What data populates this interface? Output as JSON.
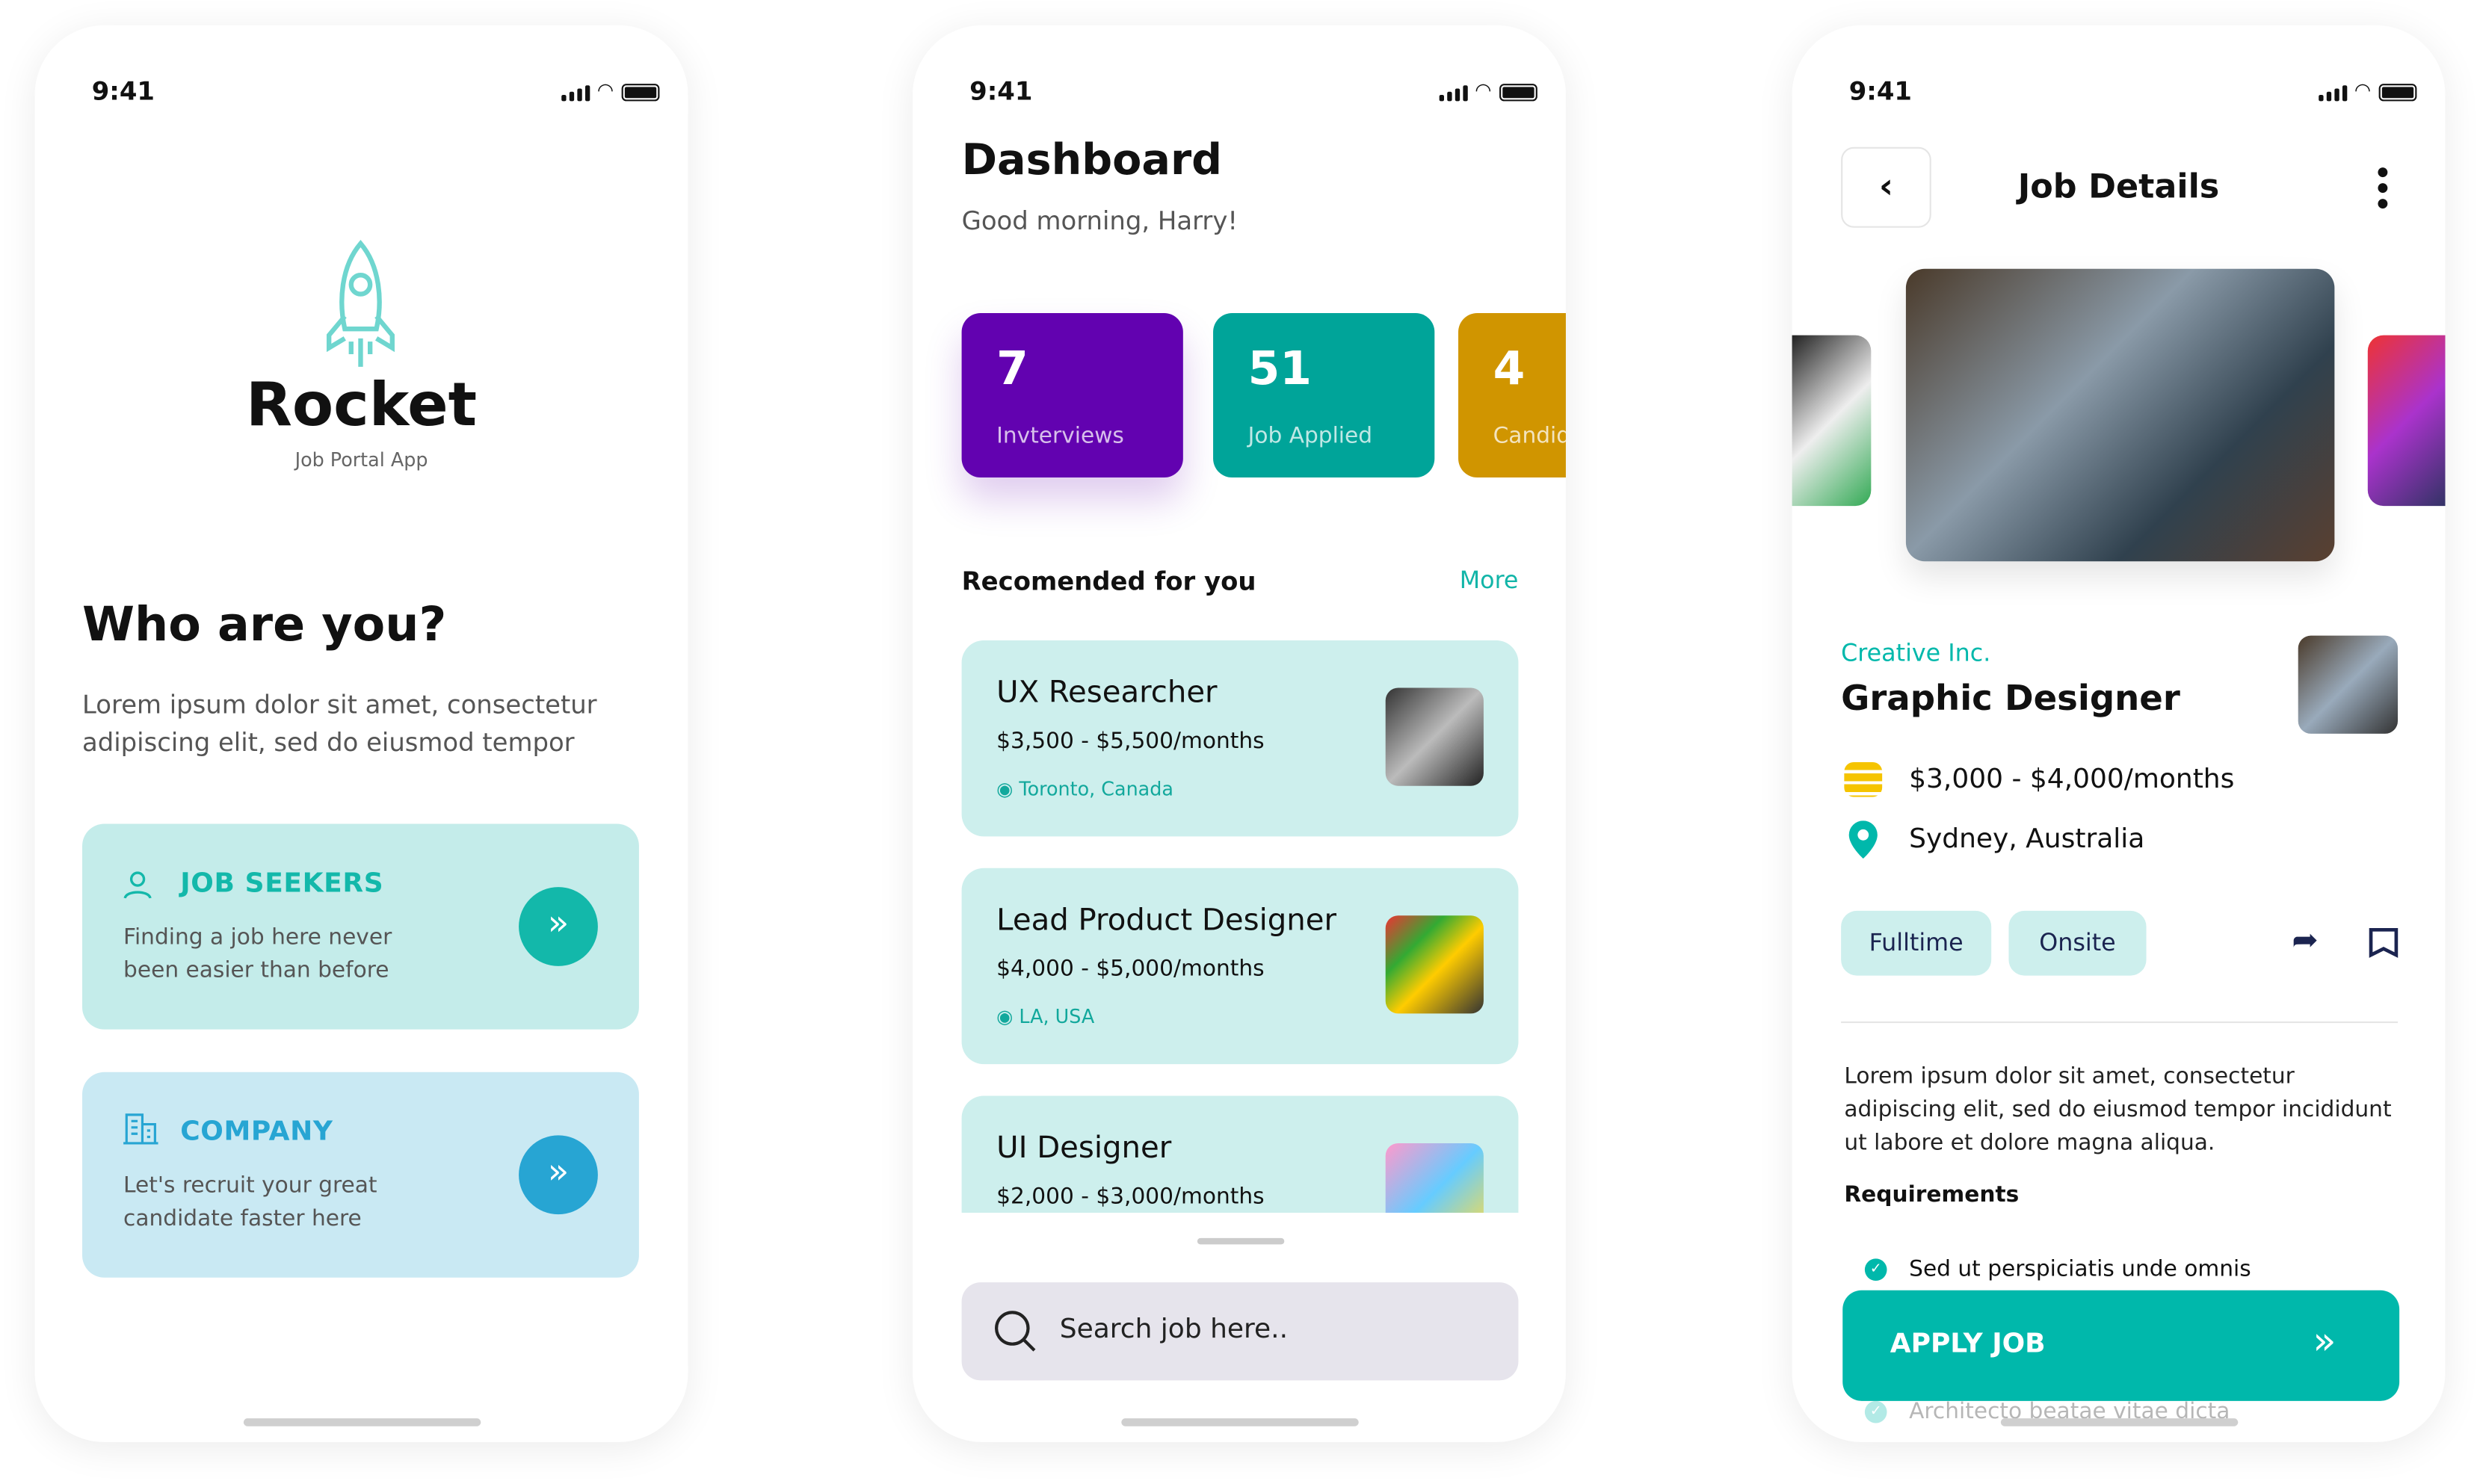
{
  "status_bar": {
    "time": "9:41"
  },
  "welcome": {
    "app_name": "Rocket",
    "app_subtitle": "Job Portal App",
    "heading": "Who are you?",
    "intro": "Lorem ipsum dolor sit amet, consectetur adipiscing elit, sed do eiusmod tempor",
    "roles": [
      {
        "title": "JOB SEEKERS",
        "description": "Finding a job here never been easier than before",
        "icon": "user-icon",
        "bg": "#c4ecea",
        "accent": "#13b8aa"
      },
      {
        "title": "COMPANY",
        "description": "Let's recruit your great candidate faster here",
        "icon": "building-icon",
        "bg": "#c9e9f3",
        "accent": "#27a5d3"
      }
    ]
  },
  "dashboard": {
    "title": "Dashboard",
    "greeting": "Good morning, Harry!",
    "stats": [
      {
        "value": "7",
        "label": "Invterviews",
        "color": "#6202b0"
      },
      {
        "value": "51",
        "label": "Job Applied",
        "color": "#00a499"
      },
      {
        "value": "4",
        "label": "Candidates",
        "color": "#d09500"
      }
    ],
    "section_title": "Recomended for you",
    "more_label": "More",
    "jobs": [
      {
        "title": "UX Researcher",
        "salary": "$3,500 - $5,500/months",
        "location": "Toronto, Canada"
      },
      {
        "title": "Lead Product Designer",
        "salary": "$4,000 - $5,000/months",
        "location": "LA, USA"
      },
      {
        "title": "UI Designer",
        "salary": "$2,000 - $3,000/months",
        "location": ""
      }
    ],
    "search_placeholder": "Search job here.."
  },
  "job_details": {
    "title": "Job Details",
    "company": "Creative Inc.",
    "position": "Graphic Designer",
    "salary": "$3,000 - $4,000/months",
    "location": "Sydney, Australia",
    "tags": [
      "Fulltime",
      "Onsite"
    ],
    "description": "Lorem ipsum dolor sit amet, consectetur adipiscing elit, sed do eiusmod tempor incididunt ut labore et dolore magna aliqua.",
    "requirements_title": "Requirements",
    "requirements": [
      "Sed ut perspiciatis unde omnis",
      "Architecto beatae vitae dicta"
    ],
    "apply_label": "APPLY JOB",
    "accent": "#00b8ab"
  }
}
